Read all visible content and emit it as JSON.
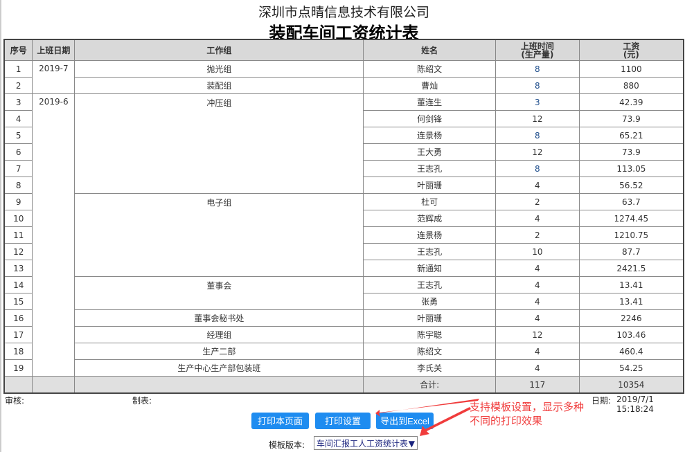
{
  "company": "深圳市点晴信息技术有限公司",
  "title": "装配车间工资统计表",
  "headers": [
    "序号",
    "上班日期",
    "工作组",
    "姓名",
    "上班时间\n(生产量)",
    "工资\n(元)"
  ],
  "headers_split": {
    "hours": [
      "上班时间",
      "(生产量)"
    ],
    "wage": [
      "工资",
      "(元)"
    ]
  },
  "rows": [
    {
      "no": "1",
      "name": "陈绍文",
      "hours": "8",
      "wage": "1100"
    },
    {
      "no": "2",
      "name": "曹灿",
      "hours": "8",
      "wage": "880"
    },
    {
      "no": "3",
      "name": "董连生",
      "hours": "3",
      "wage": "42.39"
    },
    {
      "no": "4",
      "name": "何剑锋",
      "hours": "12",
      "wage": "73.9"
    },
    {
      "no": "5",
      "name": "连景杨",
      "hours": "8",
      "wage": "65.21"
    },
    {
      "no": "6",
      "name": "王大勇",
      "hours": "12",
      "wage": "73.9"
    },
    {
      "no": "7",
      "name": "王志孔",
      "hours": "8",
      "wage": "113.05"
    },
    {
      "no": "8",
      "name": "叶丽珊",
      "hours": "4",
      "wage": "56.52"
    },
    {
      "no": "9",
      "name": "杜可",
      "hours": "2",
      "wage": "63.7"
    },
    {
      "no": "10",
      "name": "范辉成",
      "hours": "4",
      "wage": "1274.45"
    },
    {
      "no": "11",
      "name": "连景杨",
      "hours": "2",
      "wage": "1210.75"
    },
    {
      "no": "12",
      "name": "王志孔",
      "hours": "10",
      "wage": "87.7"
    },
    {
      "no": "13",
      "name": "新通知",
      "hours": "4",
      "wage": "2421.5"
    },
    {
      "no": "14",
      "name": "王志孔",
      "hours": "4",
      "wage": "13.41"
    },
    {
      "no": "15",
      "name": "张勇",
      "hours": "4",
      "wage": "13.41"
    },
    {
      "no": "16",
      "name": "叶丽珊",
      "hours": "4",
      "wage": "2246"
    },
    {
      "no": "17",
      "name": "陈宇聪",
      "hours": "12",
      "wage": "103.46"
    },
    {
      "no": "18",
      "name": "陈绍文",
      "hours": "4",
      "wage": "460.4"
    },
    {
      "no": "19",
      "name": "李氏关",
      "hours": "4",
      "wage": "54.25"
    }
  ],
  "dates": [
    {
      "label": "2019-7",
      "start": 0,
      "span": 2
    },
    {
      "label": "2019-6",
      "start": 2,
      "span": 17
    }
  ],
  "groups": [
    {
      "label": "抛光组",
      "start": 0,
      "span": 1
    },
    {
      "label": "装配组",
      "start": 1,
      "span": 1
    },
    {
      "label": "冲压组",
      "start": 2,
      "span": 6
    },
    {
      "label": "电子组",
      "start": 8,
      "span": 5
    },
    {
      "label": "董事会",
      "start": 13,
      "span": 2
    },
    {
      "label": "董事会秘书处",
      "start": 15,
      "span": 1
    },
    {
      "label": "经理组",
      "start": 16,
      "span": 1
    },
    {
      "label": "生产二部",
      "start": 17,
      "span": 1
    },
    {
      "label": "生产中心生产部包装班",
      "start": 18,
      "span": 1
    }
  ],
  "total": {
    "label": "合计:",
    "hours": "117",
    "wage": "10354"
  },
  "footer": {
    "review": "审核:",
    "maker": "制表:",
    "date_label": "日期:",
    "date": "2019/7/1 15:18:24"
  },
  "buttons": {
    "print_page": "打印本页面",
    "print_settings": "打印设置",
    "export_excel": "导出到Excel"
  },
  "template": {
    "label": "模板版本:",
    "value": "车间汇报工人工资统计表"
  },
  "annotation": [
    "支持模板设置，显示多种",
    "不同的打印效果"
  ],
  "colors": {
    "button": "#1e8cf0",
    "annotation": "#f03c3c",
    "header_bg": "#d9d9d9"
  }
}
